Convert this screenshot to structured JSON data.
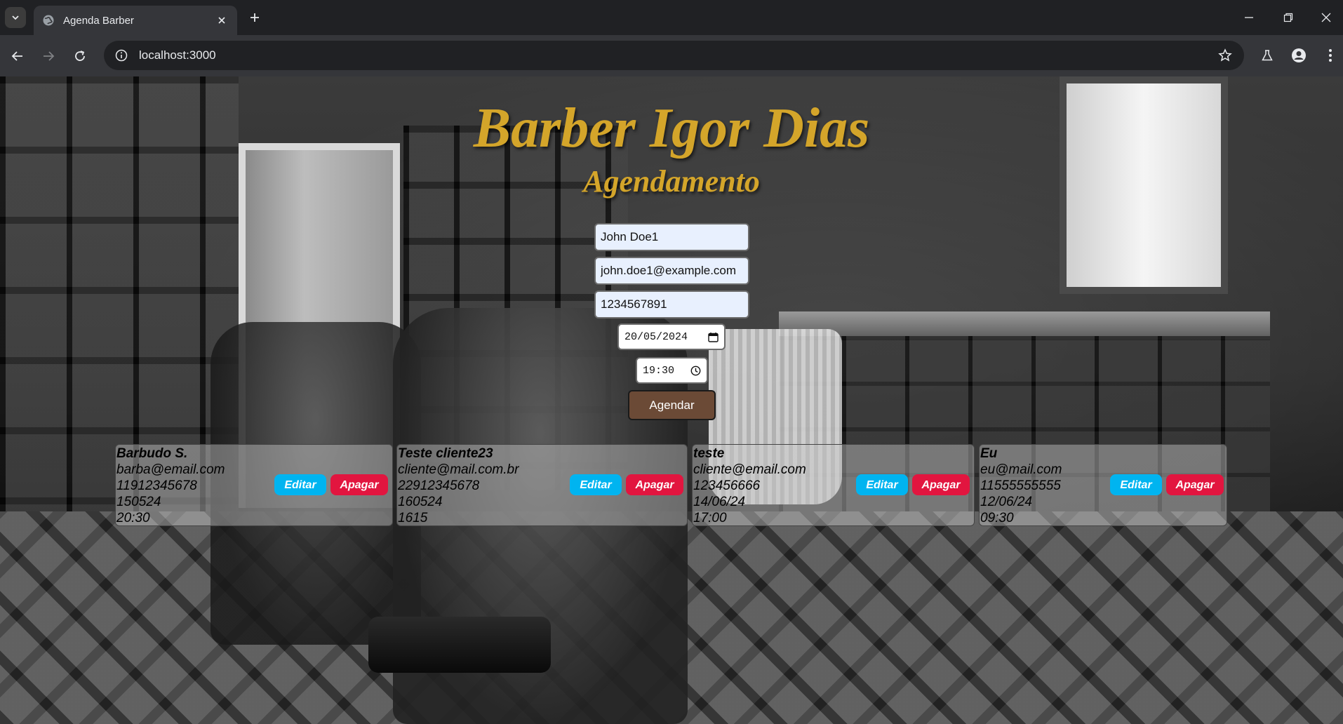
{
  "browser": {
    "tab_title": "Agenda Barber",
    "url": "localhost:3000"
  },
  "page": {
    "title": "Barber Igor Dias",
    "subtitle": "Agendamento",
    "form": {
      "name_value": "John Doe1",
      "email_value": "john.doe1@example.com",
      "phone_value": "1234567891",
      "date_value": "20/05/2024",
      "time_value": "19:30",
      "submit_label": "Agendar"
    },
    "edit_label": "Editar",
    "delete_label": "Apagar",
    "appointments": [
      {
        "name": "Barbudo S.",
        "email": "barba@email.com",
        "phone": "11912345678",
        "date": "150524",
        "time": "20:30"
      },
      {
        "name": "Teste cliente23",
        "email": "cliente@mail.com.br",
        "phone": "22912345678",
        "date": "160524",
        "time": "1615"
      },
      {
        "name": "teste",
        "email": "cliente@email.com",
        "phone": "123456666",
        "date": "14/06/24",
        "time": "17:00"
      },
      {
        "name": "Eu",
        "email": "eu@mail.com",
        "phone": "11555555555",
        "date": "12/06/24",
        "time": "09:30"
      }
    ]
  },
  "colors": {
    "title_gold": "#d4a52a",
    "submit_brown": "#6b4a36",
    "edit_blue": "#00b4f0",
    "delete_red": "#e2153f"
  }
}
